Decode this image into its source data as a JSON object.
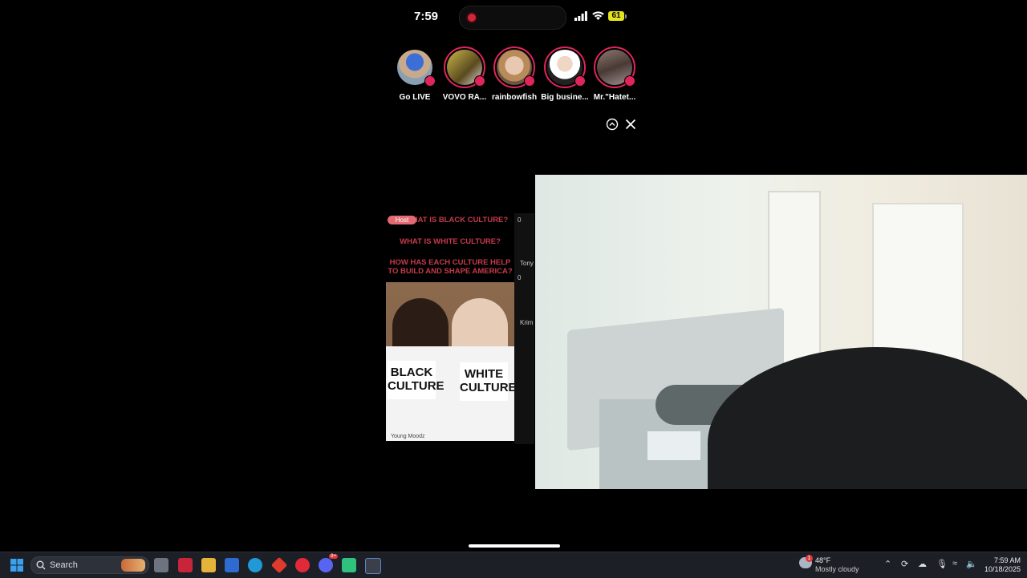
{
  "status_bar": {
    "time": "7:59",
    "battery": "61"
  },
  "stories": [
    {
      "label": "Go LIVE"
    },
    {
      "label": "VOVO RA..."
    },
    {
      "label": "rainbowfish"
    },
    {
      "label": "Big busine..."
    },
    {
      "label": "Mr.\"Hatet..."
    }
  ],
  "stream": {
    "host_badge": "Host",
    "line1": "WHAT IS BLACK CULTURE?",
    "line2": "WHAT IS WHITE CULTURE?",
    "line3": "HOW HAS EACH CULTURE HELP TO BUILD AND SHAPE AMERICA?",
    "sign_left": "BLACK CULTURE",
    "sign_right": "WHITE CULTURE",
    "watermark": "Young Moodz",
    "guest1_count": "0",
    "guest1_name": "Tony",
    "guest2_count": "0",
    "guest2_name": "Krim"
  },
  "taskbar": {
    "search_placeholder": "Search",
    "discord_badge": "9+",
    "weather_temp": "48°F",
    "weather_desc": "Mostly cloudy",
    "weather_badge": "1",
    "time": "7:59 AM",
    "date": "10/18/2025"
  }
}
